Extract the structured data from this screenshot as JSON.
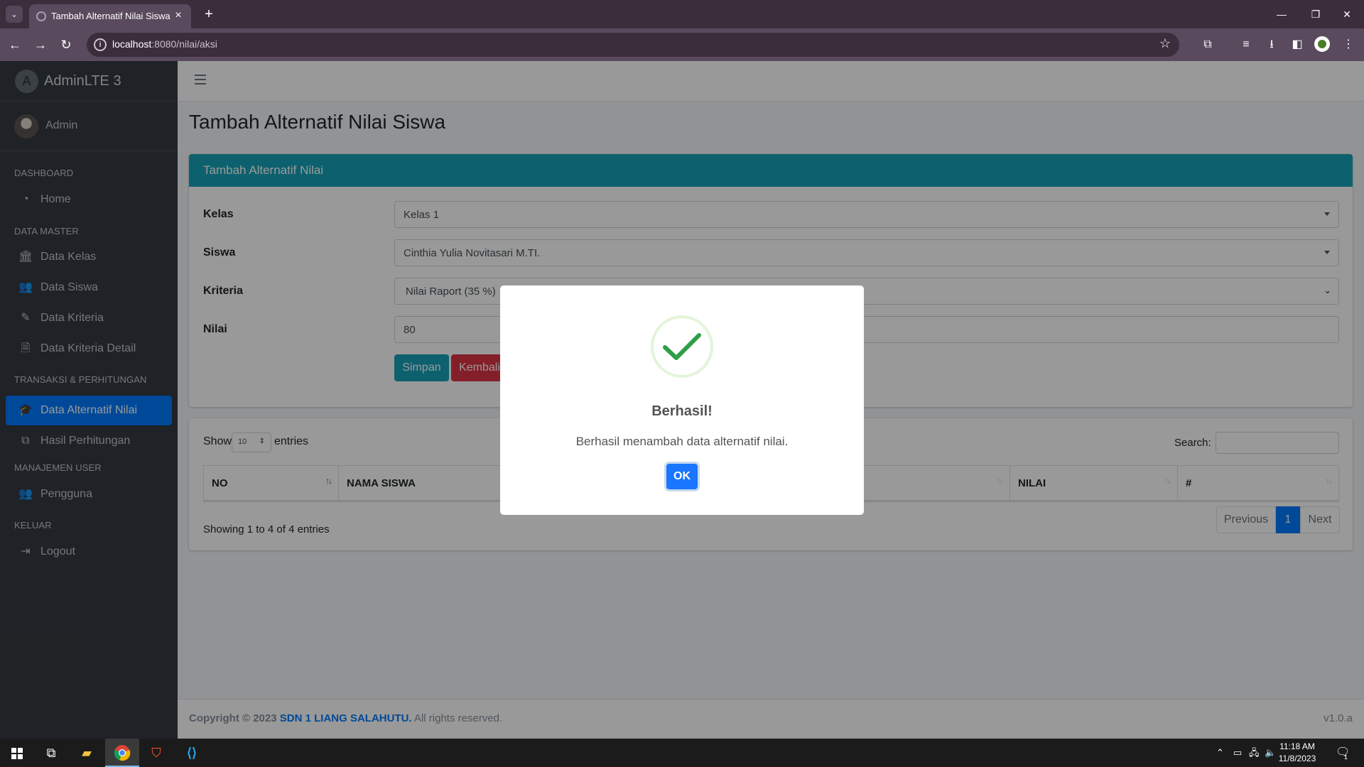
{
  "browser": {
    "tab_title": "Tambah Alternatif Nilai Siswa |",
    "url_host": "localhost",
    "url_rest": ":8080/nilai/aksi"
  },
  "sidebar": {
    "brand": "AdminLTE 3",
    "user": "Admin",
    "headers": {
      "dashboard": "DASHBOARD",
      "master": "DATA MASTER",
      "transaksi": "TRANSAKSI & PERHITUNGAN",
      "user": "MANAJEMEN USER",
      "keluar": "KELUAR"
    },
    "items": {
      "home": "Home",
      "kelas": "Data Kelas",
      "siswa": "Data Siswa",
      "kriteria": "Data Kriteria",
      "kriteria_detail": "Data Kriteria Detail",
      "alternatif": "Data Alternatif Nilai",
      "hasil": "Hasil Perhitungan",
      "pengguna": "Pengguna",
      "logout": "Logout"
    }
  },
  "main": {
    "title": "Tambah Alternatif Nilai Siswa",
    "card_title": "Tambah Alternatif Nilai",
    "form": {
      "kelas_label": "Kelas",
      "kelas_value": "Kelas 1",
      "siswa_label": "Siswa",
      "siswa_value": "Cinthia Yulia Novitasari M.TI.",
      "kriteria_label": "Kriteria",
      "kriteria_value": "Nilai Raport (35 %)",
      "nilai_label": "Nilai",
      "nilai_value": "80",
      "save": "Simpan",
      "back": "Kembali"
    },
    "table": {
      "show": "Show",
      "length": "10",
      "entries": "entries",
      "search": "Search:",
      "columns": [
        "NO",
        "NAMA SISWA",
        "NILAI",
        "#"
      ],
      "info": "Showing 1 to 4 of 4 entries",
      "prev": "Previous",
      "page": "1",
      "next": "Next"
    }
  },
  "footer": {
    "copyright": "Copyright © 2023",
    "org": "SDN 1 LIANG SALAHUTU.",
    "rights": "All rights reserved.",
    "version": "v1.0.a"
  },
  "modal": {
    "title": "Berhasil!",
    "text": "Berhasil menambah data alternatif nilai.",
    "ok": "OK",
    "success_color": "#2e9e48"
  },
  "taskbar": {
    "time": "11:18 AM",
    "date": "11/8/2023",
    "notif_count": "1"
  }
}
